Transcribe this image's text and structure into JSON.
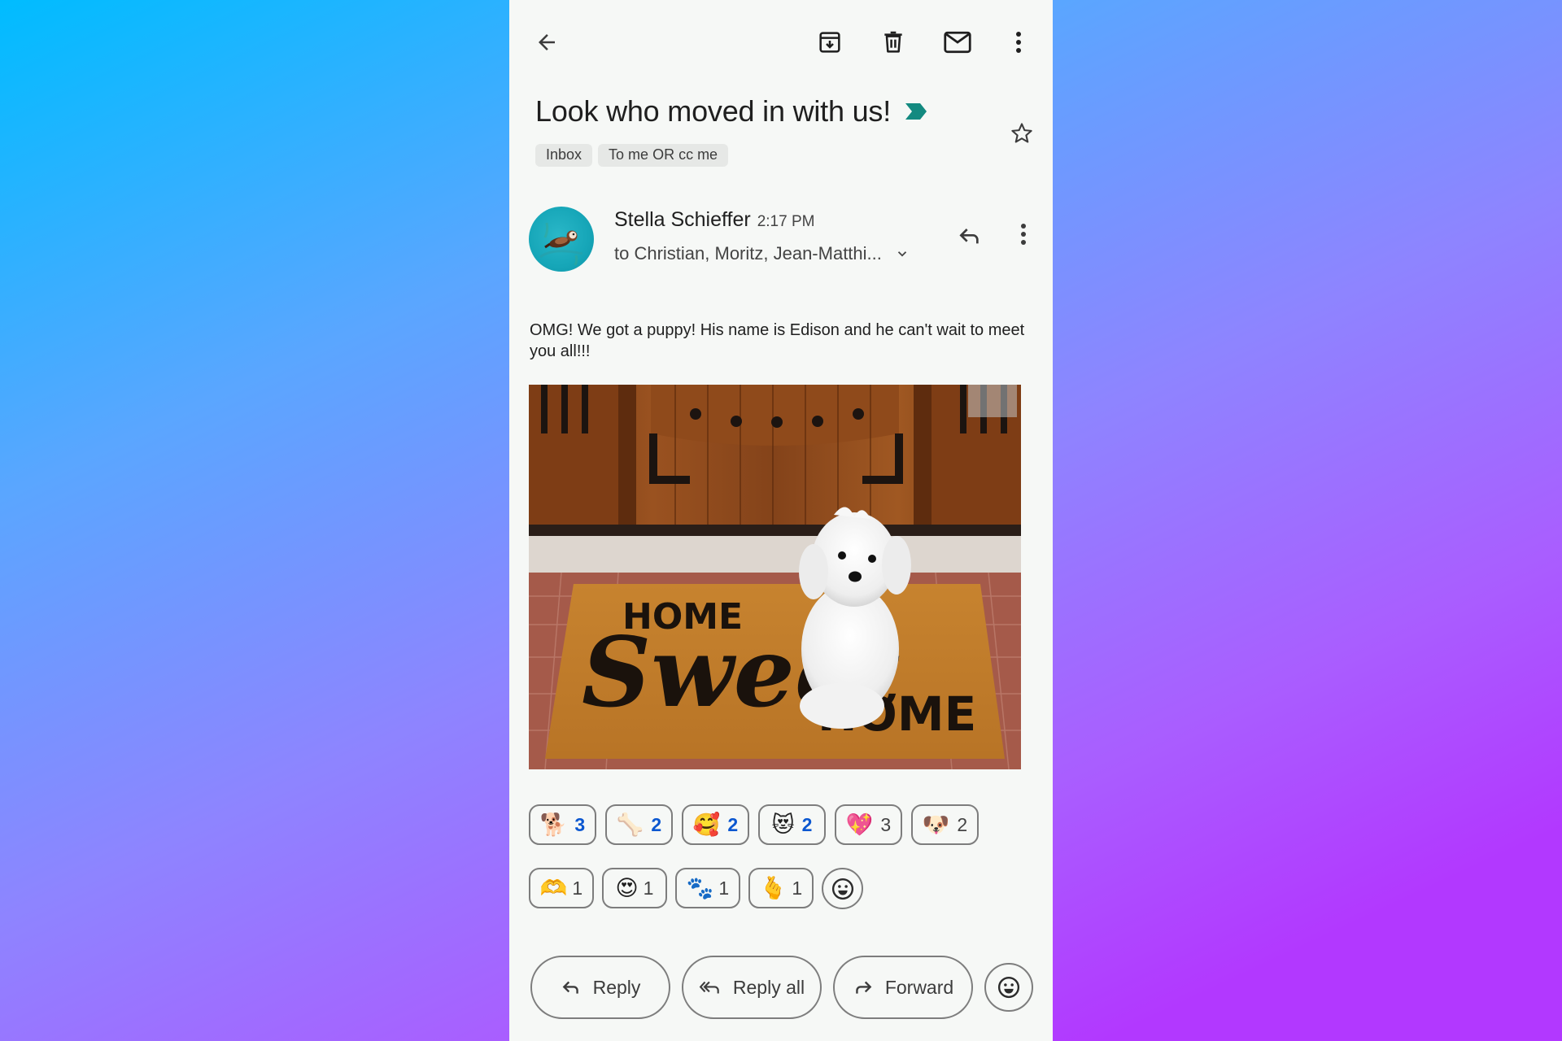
{
  "colors": {
    "background_gradient_start": "#00bcff",
    "background_gradient_end": "#b238ff",
    "panel_background": "#f6f8f6",
    "importance_marker": "#138a80",
    "reacted_count": "#0b57d0",
    "label_chip": "#e6e8e6"
  },
  "toolbar": {
    "back_icon": "arrow-left-icon",
    "archive_icon": "archive-icon",
    "delete_icon": "trash-icon",
    "mark_unread_icon": "mail-icon",
    "more_icon": "more-vert-icon"
  },
  "email": {
    "subject": "Look who moved in with us!",
    "importance_icon": "importance-marker-icon",
    "starred": false,
    "labels": [
      "Inbox",
      "To me OR cc me"
    ],
    "sender": {
      "name": "Stella Schieffer",
      "time": "2:17 PM",
      "recipients": "to Christian, Moritz, Jean-Matthi...",
      "avatar_icon": "sea-otter-avatar"
    },
    "body": "OMG! We got a puppy! His name is Edison and he can't wait to meet you all!!!",
    "attachment": {
      "type": "inline-image",
      "description": "White puppy sitting on a 'Home Sweet Home' doormat in front of a wooden door",
      "doormat_text_top": "HOME",
      "doormat_text_script": "Sweet",
      "doormat_text_bottom": "HOME"
    }
  },
  "reactions": {
    "row1": [
      {
        "emoji": "🐕",
        "name": "dog",
        "count": "3",
        "reacted_by_me": true
      },
      {
        "emoji": "🦴",
        "name": "bone",
        "count": "2",
        "reacted_by_me": true
      },
      {
        "emoji": "🥰",
        "name": "smiling-face-with-hearts",
        "count": "2",
        "reacted_by_me": true
      },
      {
        "emoji": "😻",
        "name": "heart-eyes-cat",
        "count": "2",
        "reacted_by_me": true
      },
      {
        "emoji": "💖",
        "name": "sparkling-heart",
        "count": "3",
        "reacted_by_me": false
      },
      {
        "emoji": "🐶",
        "name": "dog-face",
        "count": "2",
        "reacted_by_me": false
      }
    ],
    "row2": [
      {
        "emoji": "🫶",
        "name": "heart-hands",
        "count": "1",
        "reacted_by_me": false
      },
      {
        "emoji": "😍",
        "name": "heart-eyes",
        "count": "1",
        "reacted_by_me": false
      },
      {
        "emoji": "🐾",
        "name": "paw-prints",
        "count": "1",
        "reacted_by_me": false
      },
      {
        "emoji": "🫰",
        "name": "finger-heart",
        "count": "1",
        "reacted_by_me": false
      }
    ],
    "add_reaction_icon": "add-emoji-icon"
  },
  "actions": {
    "reply_label": "Reply",
    "reply_all_label": "Reply all",
    "forward_label": "Forward",
    "emoji_icon": "add-emoji-icon"
  }
}
